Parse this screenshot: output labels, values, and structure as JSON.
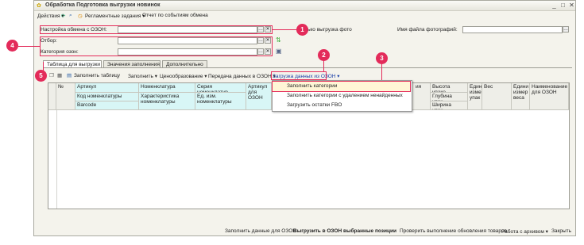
{
  "window": {
    "title": "Обработка  Подготовка выгрузки новинок",
    "controls": {
      "minimize": "_",
      "maximize": "□",
      "close": "✕"
    }
  },
  "menubar": {
    "actions": "Действия ▾",
    "scheduled": "Регламентные задания ▾",
    "report": "Отчет по событиям обмена"
  },
  "form": {
    "exchange_label": "Настройка обмена с ОЗОН:",
    "exchange_value": "",
    "only_photo_label": "ько выгрузка фото",
    "photo_file_label": "Имя файла фотографий:",
    "photo_file_value": "",
    "filter_label": "Отбор:",
    "filter_value": "",
    "category_label": "Категория озон:",
    "category_value": ""
  },
  "tabs": [
    {
      "label": "Таблица для выгрузки",
      "active": true
    },
    {
      "label": "Значения заполнения",
      "active": false
    },
    {
      "label": "Дополнительно",
      "active": false
    }
  ],
  "toolbar": {
    "fill_table": "Заполнить таблицу",
    "fill": "Заполнить ▾",
    "pricing": "Ценообразование ▾",
    "send_ozon": "Передача данных в ОЗОН ▾",
    "load_ozon": "Загрузка данных из ОЗОН ▾"
  },
  "dropdown": {
    "items": [
      "Заполнить категории",
      "Заполнить категории с удалением ненайденных",
      "Загрузить остатки FBO"
    ]
  },
  "grid": {
    "headers": {
      "num": "№",
      "article": "Артикул",
      "item_code": "Код номенклатуры",
      "barcode": "Barcode",
      "nomenclature": "Номенклатура",
      "characteristic": "Характеристика номенклатуры",
      "series": "Серия номенклатур...",
      "unit": "Ед. изм. номенклатуры",
      "ozon_article": "Артикул для ОЗОН",
      "col_ia": "ия",
      "pack_height": "Высота упако...",
      "pack_depth": "Глубина упак...",
      "pack_width": "Ширина упак...",
      "unit_measure_pack": "Един изме упак",
      "weight": "Вес",
      "unit_measure_weight": "Едини измер веса",
      "ozon_name": "Наименование для ОЗОН"
    }
  },
  "footer": {
    "fill_ozon": "Заполнить данные для ОЗОН",
    "upload_selected": "Выгрузить в ОЗОН выбранные позиции",
    "check_updates": "Проверить выполнение обновления товаров",
    "archive": "Работа с архивом ▾",
    "close": "Закрыть"
  },
  "callouts": [
    "1",
    "2",
    "3",
    "4",
    "5"
  ],
  "colors": {
    "callout": "#e32b5a",
    "header_cyan": "#d8f6f6"
  }
}
